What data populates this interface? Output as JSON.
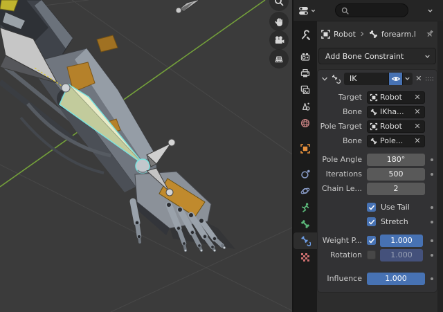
{
  "viewport": {
    "nav_icons": [
      "zoom",
      "pan",
      "camera",
      "toggle-grid"
    ],
    "background": "#3b3b3b",
    "axis_green": "#74a13a",
    "selected_bone": {
      "fill": "#e9ebc8",
      "outline": "#7ae2de"
    }
  },
  "panel": {
    "search": {
      "placeholder": ""
    },
    "breadcrumb": {
      "object": "Robot",
      "bone": "forearm.l"
    },
    "add_constraint_label": "Add Bone Constraint",
    "tabs": {
      "items": [
        "tool",
        "render",
        "output",
        "view-layer",
        "scene",
        "world",
        "object",
        "physics",
        "constraints",
        "object-data",
        "bone",
        "bone-constraint",
        "texture"
      ],
      "active": "bone-constraint"
    },
    "icons": {
      "close": "✕"
    },
    "constraint": {
      "name": "IK",
      "fields": {
        "target": {
          "label": "Target",
          "value": "Robot"
        },
        "target_bone": {
          "label": "Bone",
          "value": "IKha..."
        },
        "pole_target": {
          "label": "Pole Target",
          "value": "Robot"
        },
        "pole_bone": {
          "label": "Bone",
          "value": "Pole..."
        },
        "pole_angle": {
          "label": "Pole Angle",
          "value": "180°"
        },
        "iterations": {
          "label": "Iterations",
          "value": "500"
        },
        "chain_length": {
          "label": "Chain Le...",
          "value": "2"
        },
        "use_tail": {
          "label": "Use Tail",
          "checked": true
        },
        "stretch": {
          "label": "Stretch",
          "checked": true
        },
        "weight_position": {
          "label": "Weight P...",
          "checked": true,
          "value": "1.000"
        },
        "rotation": {
          "label": "Rotation",
          "checked": false,
          "value": "1.000"
        },
        "influence": {
          "label": "Influence",
          "value": "1.000"
        }
      }
    }
  },
  "colors": {
    "accent_blue": "#4772b3",
    "object_orange": "#e8913c",
    "data_green": "#5cb87a",
    "world_red": "#cc8484",
    "texture_red": "#cf7070"
  }
}
